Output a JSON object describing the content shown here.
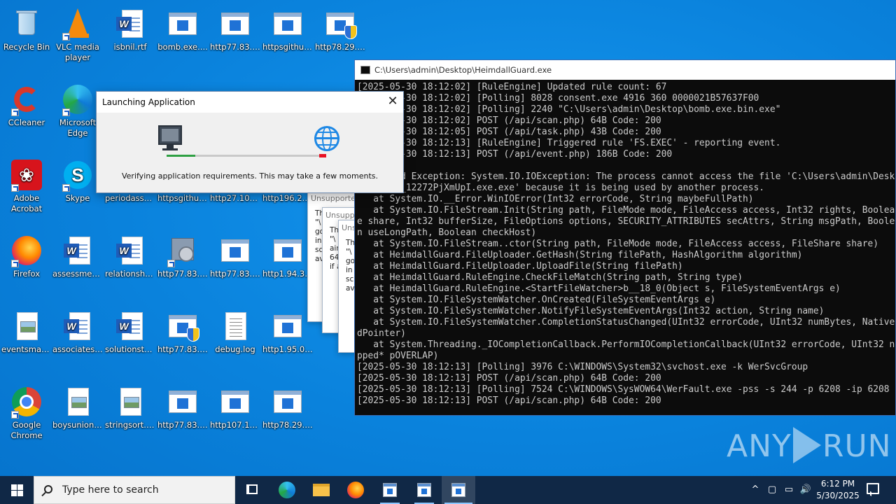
{
  "desktop": {
    "icons": {
      "recycle_bin": "Recycle Bin",
      "vlc": "VLC media player",
      "isbnil": "isbnil.rtf",
      "bomb": "bomb.exe....",
      "http77_a": "http77.83.2...",
      "httpsgithub_a": "httpsgithub...",
      "http78_a": "http78.29.4...",
      "ccleaner": "CCleaner",
      "edge": "Microsoft Edge",
      "adobe": "Adobe Acrobat",
      "skype": "Skype",
      "periodasse": "periodasse...",
      "httpsgithub_b": "httpsgithub...",
      "http27": "http27.106....",
      "http196": "http196.251....",
      "firefox": "Firefox",
      "assessmen": "assessmen...",
      "relationshe": "relationshe...",
      "http77_b": "http77.83.2...",
      "http77_c": "http77.83.2...",
      "http1_94": "http1.94.35....",
      "eventsmarc": "eventsmarc...",
      "associatesd": "associatesd...",
      "solutionsta": "solutionsta...",
      "http77_d": "http77.83.2...",
      "debuglog": "debug.log",
      "http1_95": "http1.95.0....",
      "chrome": "Google Chrome",
      "boysunion": "boysunion....",
      "stringsort": "stringsort.jpg",
      "http77_e": "http77.83.2...",
      "http107": "http107.175....",
      "http78_b": "http78.29.4..."
    }
  },
  "launcher": {
    "title": "Launching Application",
    "message": "Verifying application requirements. This may take a few moments.",
    "close_glyph": "✕"
  },
  "unsupported": {
    "title_1": "Unsupporte",
    "title_2": "Unsupp",
    "title_3": "Uns",
    "body_1": "Th\n\"\\\ngo\nin\nsc\nav",
    "body_2": "Th\n\"\\\nair\n64\nif a",
    "body_3": "Th\n\"\\\ngo\nin\nsc\nav"
  },
  "console": {
    "title": "C:\\Users\\admin\\Desktop\\HeimdallGuard.exe",
    "lines": [
      "[2025-05-30 18:12:02] [RuleEngine] Updated rule count: 67",
      "[2025-05-30 18:12:02] [Polling] 8028 consent.exe 4916 360 0000021B57637F00",
      "[2025-05-30 18:12:02] [Polling] 2240 \"C:\\Users\\admin\\Desktop\\bomb.exe.bin.exe\"",
      "[2025-05-30 18:12:02] POST (/api/scan.php) 64B Code: 200",
      "[2025-05-30 18:12:05] POST (/api/task.php) 43B Code: 200",
      "[2025-05-30 18:12:13] [RuleEngine] Triggered rule 'FS.EXEC' - reporting event.",
      "[2025-05-30 18:12:13] POST (/api/event.php) 186B Code: 200",
      "",
      "Unhandled Exception: System.IO.IOException: The process cannot access the file 'C:\\Users\\admin\\Desktop\\",
      "bomb.exe_12272PjXmUpI.exe.exe' because it is being used by another process.",
      "   at System.IO.__Error.WinIOError(Int32 errorCode, String maybeFullPath)",
      "   at System.IO.FileStream.Init(String path, FileMode mode, FileAccess access, Int32 rights, Boolean useRights, FileShar",
      "e share, Int32 bufferSize, FileOptions options, SECURITY_ATTRIBUTES secAttrs, String msgPath, Boolean bFromProxy, Boolea",
      "n useLongPath, Boolean checkHost)",
      "   at System.IO.FileStream..ctor(String path, FileMode mode, FileAccess access, FileShare share)",
      "   at HeimdallGuard.FileUploader.GetHash(String filePath, HashAlgorithm algorithm)",
      "   at HeimdallGuard.FileUploader.UploadFile(String filePath)",
      "   at HeimdallGuard.RuleEngine.CheckFileMatch(String path, String type)",
      "   at HeimdallGuard.RuleEngine.<StartFileWatcher>b__18_0(Object s, FileSystemEventArgs e)",
      "   at System.IO.FileSystemWatcher.OnCreated(FileSystemEventArgs e)",
      "   at System.IO.FileSystemWatcher.NotifyFileSystemEventArgs(Int32 action, String name)",
      "   at System.IO.FileSystemWatcher.CompletionStatusChanged(UInt32 errorCode, UInt32 numBytes, NativeOverlapped* overlappe",
      "dPointer)",
      "   at System.Threading._IOCompletionCallback.PerformIOCompletionCallback(UInt32 errorCode, UInt32 numBytes, NativeOverla",
      "pped* pOVERLAP)",
      "[2025-05-30 18:12:13] [Polling] 3976 C:\\WINDOWS\\System32\\svchost.exe -k WerSvcGroup",
      "[2025-05-30 18:12:13] POST (/api/scan.php) 64B Code: 200",
      "[2025-05-30 18:12:13] [Polling] 7524 C:\\WINDOWS\\SysWOW64\\WerFault.exe -pss -s 244 -p 6208 -ip 6208",
      "[2025-05-30 18:12:13] POST (/api/scan.php) 64B Code: 200"
    ]
  },
  "watermark": {
    "left": "ANY",
    "right": "RUN"
  },
  "taskbar": {
    "search_placeholder": "Type here to search",
    "time": "6:12 PM",
    "date": "5/30/2025",
    "tray_chevron": "^"
  }
}
